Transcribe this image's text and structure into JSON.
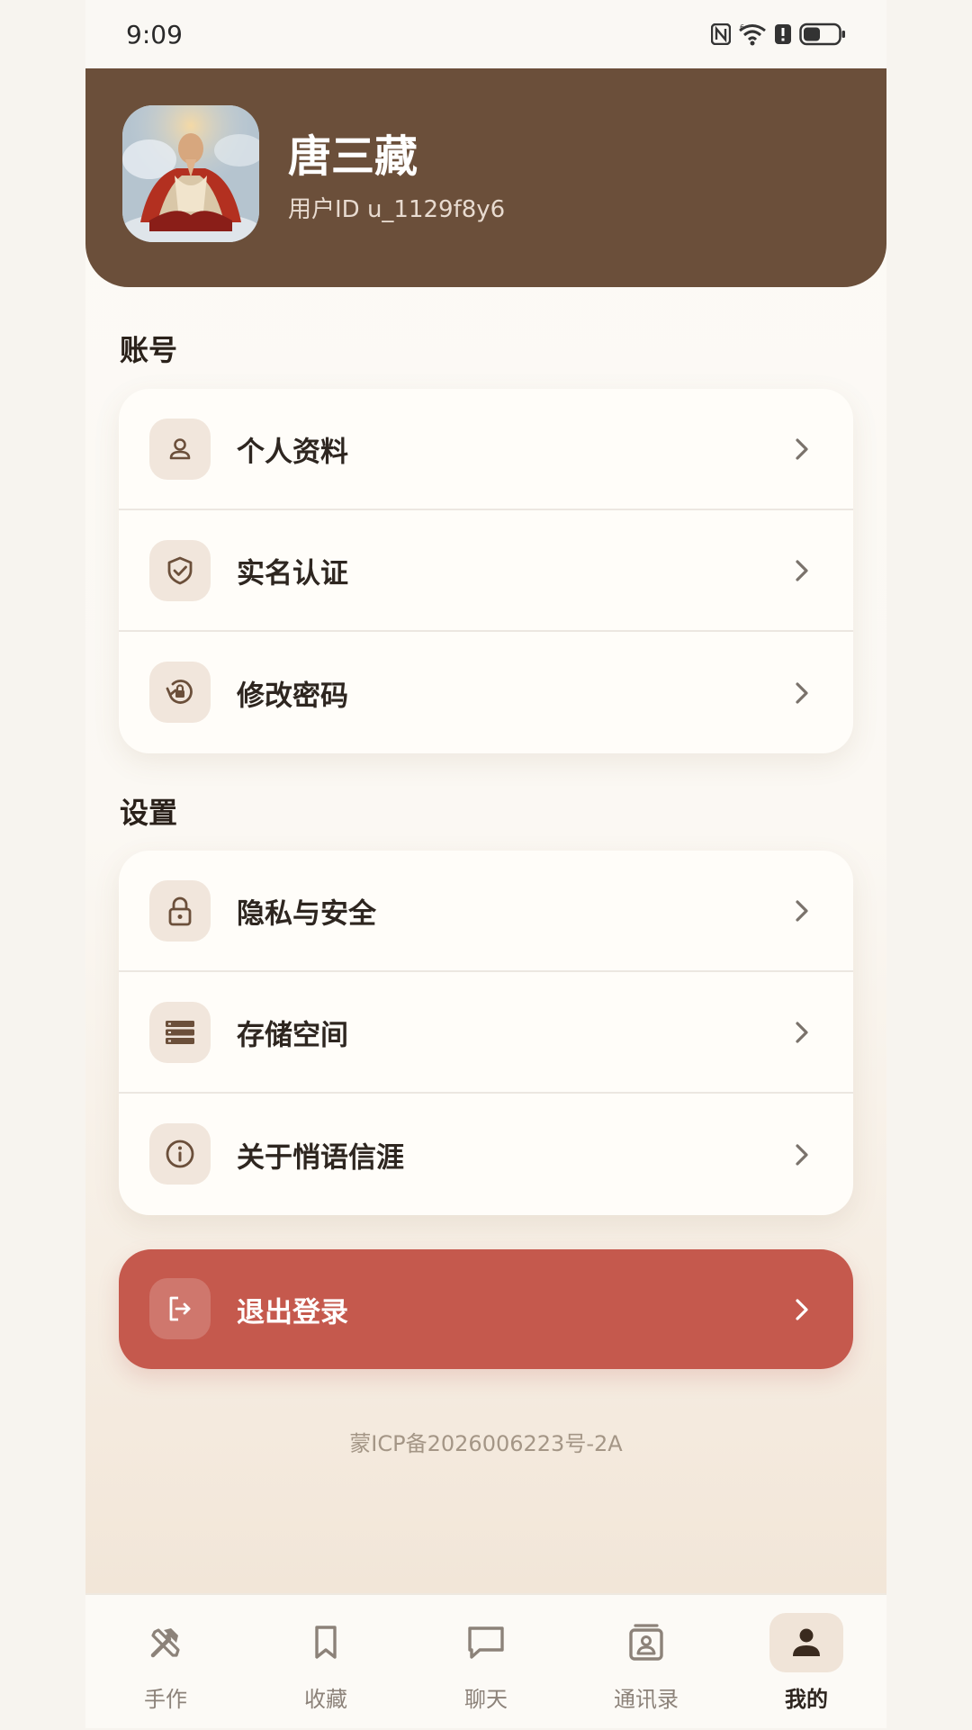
{
  "status_bar": {
    "time": "9:09"
  },
  "profile": {
    "name": "唐三藏",
    "user_id": "用户ID u_1129f8y6"
  },
  "sections": {
    "account": {
      "title": "账号",
      "items": [
        {
          "label": "个人资料",
          "icon": "person-icon"
        },
        {
          "label": "实名认证",
          "icon": "shield-check-icon"
        },
        {
          "label": "修改密码",
          "icon": "lock-reset-icon"
        }
      ]
    },
    "settings": {
      "title": "设置",
      "items": [
        {
          "label": "隐私与安全",
          "icon": "lock-icon"
        },
        {
          "label": "存储空间",
          "icon": "storage-icon"
        },
        {
          "label": "关于悄语信涯",
          "icon": "info-icon"
        }
      ]
    }
  },
  "logout": {
    "label": "退出登录",
    "icon": "logout-icon"
  },
  "footer": {
    "icp": "蒙ICP备2026006223号-2A"
  },
  "tabbar": {
    "tabs": [
      {
        "label": "手作",
        "icon": "tools-icon",
        "active": false
      },
      {
        "label": "收藏",
        "icon": "bookmark-icon",
        "active": false
      },
      {
        "label": "聊天",
        "icon": "chat-icon",
        "active": false
      },
      {
        "label": "通讯录",
        "icon": "contacts-icon",
        "active": false
      },
      {
        "label": "我的",
        "icon": "person-icon",
        "active": true
      }
    ]
  },
  "colors": {
    "header_bg": "#6b4f3a",
    "logout_bg": "#c5594d",
    "page_bg": "#fbf8f3",
    "icon_tile": "#f1e6dc"
  }
}
